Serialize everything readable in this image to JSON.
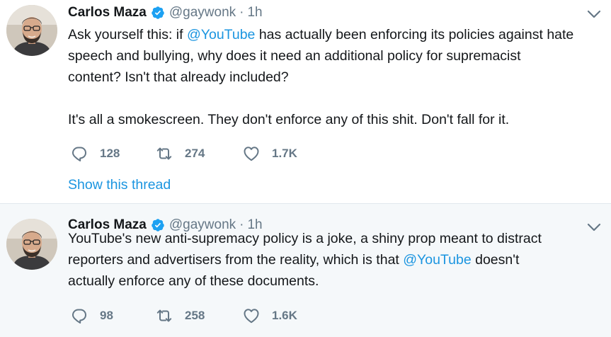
{
  "colors": {
    "link": "#1b95e0",
    "muted": "#657786",
    "verified": "#1da1f2"
  },
  "tweets": [
    {
      "author_name": "Carlos Maza",
      "handle": "@gaywonk",
      "separator": "·",
      "time": "1h",
      "text_lines": [
        {
          "pre": "Ask yourself this: if ",
          "mention": "@YouTube",
          "post": " has actually been enforcing its policies against hate"
        },
        {
          "pre": "speech and bullying, why does it need an additional policy for supremacist"
        },
        {
          "pre": "content? Isn't that already included?"
        },
        {
          "pre": ""
        },
        {
          "pre": "It's all a smokescreen. They don't enforce any of this shit. Don't fall for it."
        }
      ],
      "replies": "128",
      "retweets": "274",
      "likes": "1.7K",
      "show_thread": "Show this thread"
    },
    {
      "author_name": "Carlos Maza",
      "handle": "@gaywonk",
      "separator": "·",
      "time": "1h",
      "text_lines": [
        {
          "pre": "YouTube's new anti-supremacy policy is a joke, a shiny prop meant to distract"
        },
        {
          "pre": "reporters and advertisers from the reality, which is that ",
          "mention": "@YouTube",
          "post": " doesn't"
        },
        {
          "pre": "actually enforce any of these documents."
        }
      ],
      "replies": "98",
      "retweets": "258",
      "likes": "1.6K"
    }
  ],
  "icons": {
    "verified": "verified-badge-icon",
    "caret": "chevron-down-icon",
    "reply": "reply-icon",
    "retweet": "retweet-icon",
    "like": "heart-icon"
  }
}
